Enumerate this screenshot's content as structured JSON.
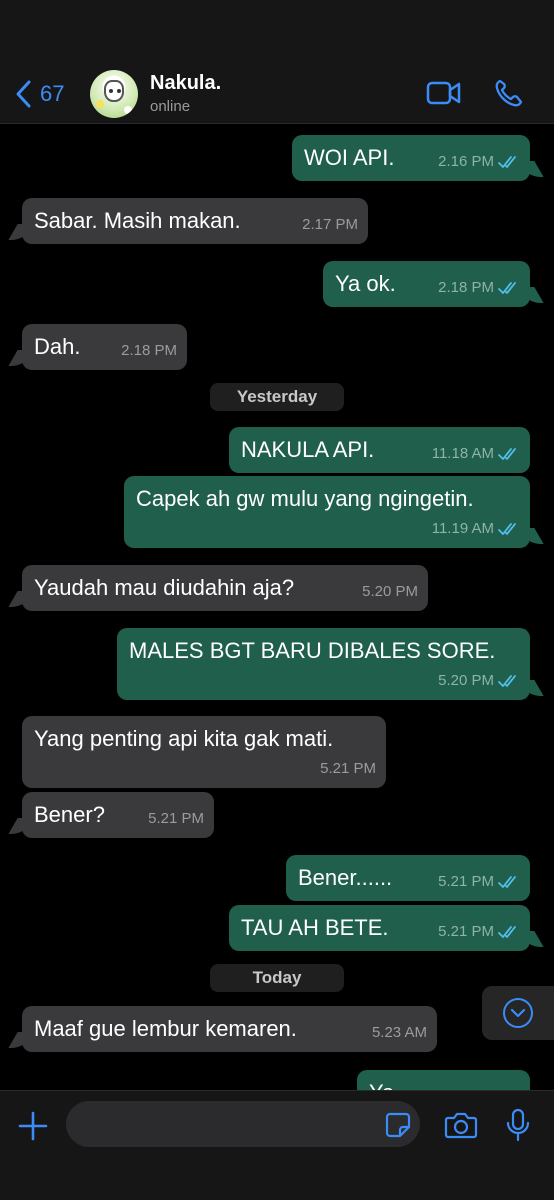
{
  "header": {
    "back_count": "67",
    "contact_name": "Nakula.",
    "contact_status": "online"
  },
  "icons": {
    "back": "chevron-left-icon",
    "video": "video-camera-icon",
    "phone": "phone-icon",
    "plus": "plus-icon",
    "sticker": "sticker-icon",
    "camera": "camera-icon",
    "mic": "microphone-icon",
    "scroll": "chevron-down-icon",
    "read": "double-check-icon"
  },
  "colors": {
    "accent": "#3b8cf6",
    "outgoing_bubble": "#1f5f4c",
    "incoming_bubble": "#3a3a3c",
    "read_ticks": "#53bdeb"
  },
  "day_separators": [
    "Yesterday",
    "Today"
  ],
  "messages": [
    {
      "dir": "out",
      "text": "WOI API.",
      "time": "2.16 PM",
      "read": true
    },
    {
      "dir": "in",
      "text": "Sabar. Masih makan.",
      "time": "2.17 PM"
    },
    {
      "dir": "out",
      "text": "Ya ok.",
      "time": "2.18 PM",
      "read": true
    },
    {
      "dir": "in",
      "text": "Dah.",
      "time": "2.18 PM"
    },
    {
      "dir": "out",
      "text": "NAKULA API.",
      "time": "11.18 AM",
      "read": true
    },
    {
      "dir": "out",
      "text": "Capek ah gw mulu yang ngingetin.",
      "time": "11.19 AM",
      "read": true
    },
    {
      "dir": "in",
      "text": "Yaudah mau diudahin aja?",
      "time": "5.20 PM"
    },
    {
      "dir": "out",
      "text": "MALES BGT BARU DIBALES SORE.",
      "time": "5.20 PM",
      "read": true
    },
    {
      "dir": "in",
      "text": "Yang penting api kita gak mati.",
      "time": "5.21 PM"
    },
    {
      "dir": "in",
      "text": "Bener?",
      "time": "5.21 PM"
    },
    {
      "dir": "out",
      "text": "Bener......",
      "time": "5.21 PM",
      "read": true
    },
    {
      "dir": "out",
      "text": "TAU AH BETE.",
      "time": "5.21 PM",
      "read": true
    },
    {
      "dir": "in",
      "text": "Maaf gue lembur kemaren.",
      "time": "5.23 AM"
    },
    {
      "dir": "out",
      "text": "Ya",
      "time": "",
      "read": false
    }
  ],
  "composer": {
    "input_value": "",
    "input_placeholder": ""
  }
}
